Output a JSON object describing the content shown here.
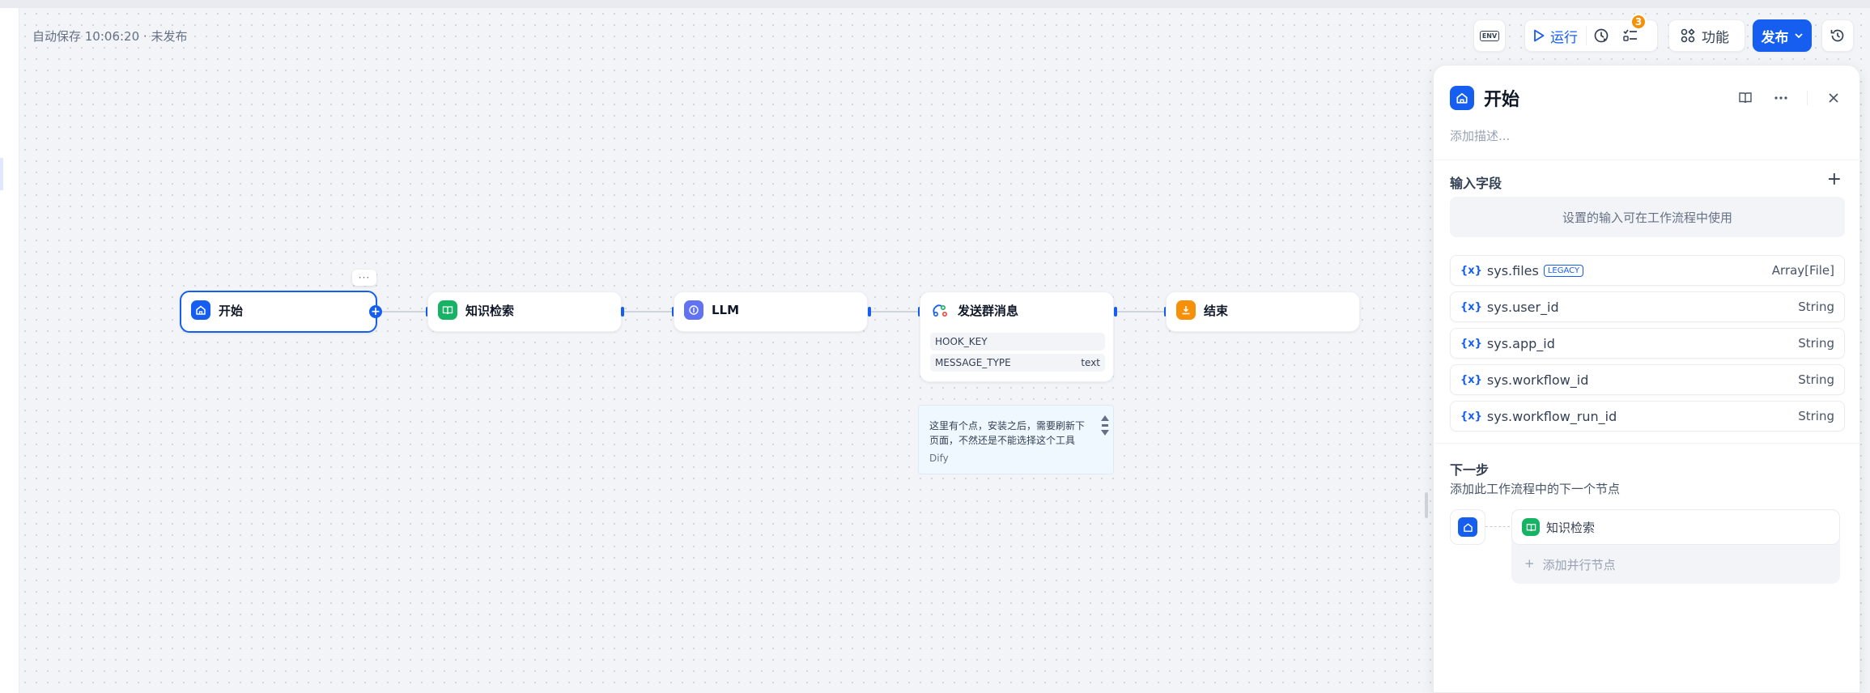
{
  "header": {
    "autosave": "自动保存 10:06:20 · 未发布"
  },
  "toolbar": {
    "env_label": "ENV",
    "run_label": "运行",
    "checklist_badge": "3",
    "features_label": "功能",
    "publish_label": "发布"
  },
  "nodes": {
    "start": {
      "title": "开始",
      "icon": "home-icon"
    },
    "knowledge": {
      "title": "知识检索",
      "icon": "book-icon"
    },
    "llm": {
      "title": "LLM",
      "icon": "llm-icon"
    },
    "send": {
      "title": "发送群消息",
      "icon": "webhook-icon",
      "params": [
        {
          "name": "HOOK_KEY",
          "value": ""
        },
        {
          "name": "MESSAGE_TYPE",
          "value": "text"
        }
      ]
    },
    "end": {
      "title": "结束",
      "icon": "end-icon"
    },
    "more_label": "···"
  },
  "note": {
    "text": "这里有个点，安装之后，需要刷新下页面，不然还是不能选择这个工具",
    "author": "Dify"
  },
  "panel": {
    "title": "开始",
    "description_placeholder": "添加描述...",
    "input_section": "输入字段",
    "input_hint": "设置的输入可在工作流程中使用",
    "variables": [
      {
        "name": "sys.files",
        "tag": "LEGACY",
        "type": "Array[File]"
      },
      {
        "name": "sys.user_id",
        "tag": "",
        "type": "String"
      },
      {
        "name": "sys.app_id",
        "tag": "",
        "type": "String"
      },
      {
        "name": "sys.workflow_id",
        "tag": "",
        "type": "String"
      },
      {
        "name": "sys.workflow_run_id",
        "tag": "",
        "type": "String"
      }
    ],
    "var_icon": "{x}",
    "next_section": "下一步",
    "next_hint": "添加此工作流程中的下一个节点",
    "next_node": "知识检索",
    "add_parallel": "添加并行节点"
  },
  "colors": {
    "accent": "#155eef",
    "knowledge": "#16b364",
    "llm": "#6172f3",
    "end": "#f79009",
    "badge": "#f79009"
  }
}
